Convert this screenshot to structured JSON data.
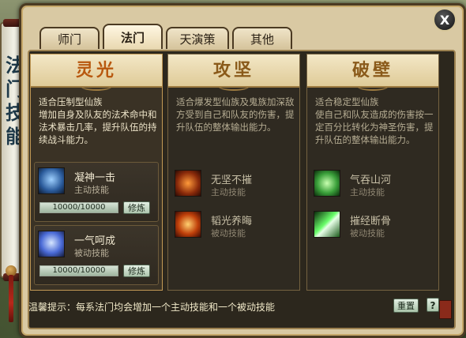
{
  "scroll_banner": {
    "text": "法门技能"
  },
  "window": {
    "close_label": "X",
    "tabs": [
      {
        "label": "师门",
        "active": false
      },
      {
        "label": "法门",
        "active": true
      },
      {
        "label": "天演策",
        "active": false
      },
      {
        "label": "其他",
        "active": false
      }
    ]
  },
  "panels": [
    {
      "title": "灵光",
      "title_color": "#b8580f",
      "description": "适合压制型仙族\n增加自身及队友的法术命中和法术暴击几率，提升队伍的持续战斗能力。",
      "skills": [
        {
          "name": "凝神一击",
          "type": "主动技能",
          "progress_text": "10000/10000",
          "progress": 1.0,
          "button": "修炼",
          "icon": "spirit-wolf-icon"
        },
        {
          "name": "一气呵成",
          "type": "被动技能",
          "progress_text": "10000/10000",
          "progress": 1.0,
          "button": "修炼",
          "icon": "blue-swirl-icon"
        }
      ]
    },
    {
      "title": "攻坚",
      "title_color": "#8a5a1a",
      "description": "适合爆发型仙族及鬼族加深敌方受到自己和队友的伤害，提升队伍的整体输出能力。",
      "skills": [
        {
          "name": "无坚不摧",
          "type": "主动技能",
          "icon": "fire-warrior-icon"
        },
        {
          "name": "韬光养晦",
          "type": "被动技能",
          "icon": "flame-burst-icon"
        }
      ]
    },
    {
      "title": "破壁",
      "title_color": "#8a5a1a",
      "description": "适合稳定型仙族\n使自己和队友造成的伤害按一定百分比转化为神圣伤害，提升队伍的整体输出能力。",
      "skills": [
        {
          "name": "气吞山河",
          "type": "主动技能",
          "icon": "green-beast-icon"
        },
        {
          "name": "摧经断骨",
          "type": "被动技能",
          "icon": "green-slash-icon"
        }
      ]
    }
  ],
  "footer": {
    "tip": "温馨提示：每系法门均会增加一个主动技能和一个被动技能",
    "reset_label": "重置",
    "help_label": "?"
  }
}
